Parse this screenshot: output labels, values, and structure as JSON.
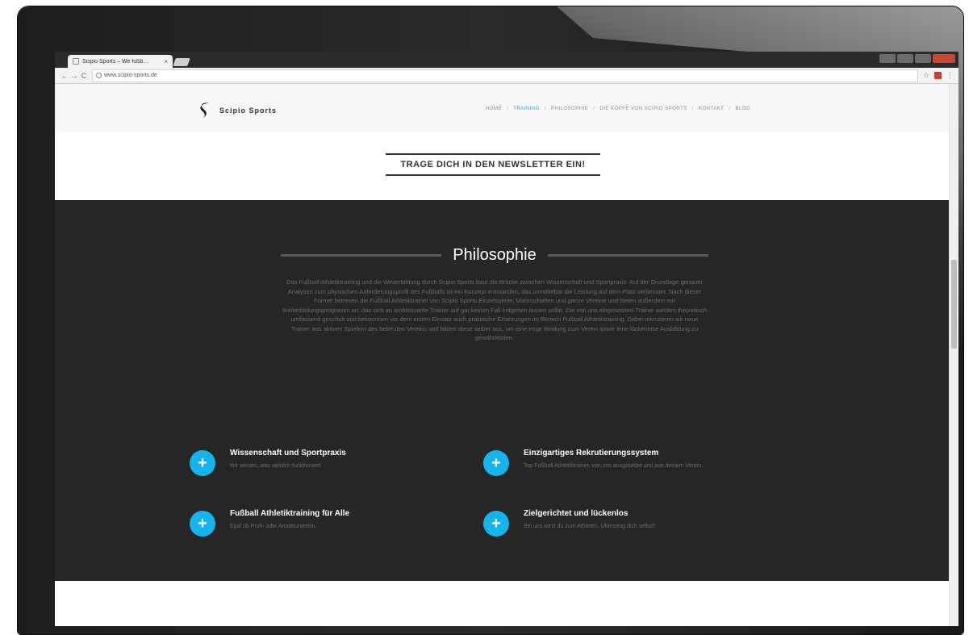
{
  "browser": {
    "tab_title": "Scipio Sports – We fußb…",
    "tab_close": "×",
    "url": "www.scipio-sports.de",
    "back": "←",
    "forward": "→",
    "reload": "C"
  },
  "site": {
    "logo_text": "Scipio Sports",
    "nav": [
      "HOME",
      "TRAINING",
      "PHILOSOPHIE",
      "DIE KÖPFE VON SCIPIO SPORTS",
      "KONTAKT",
      "BLOG"
    ],
    "nav_separator": "/",
    "active_nav": "TRAINING",
    "accent_color": "#1aa6e4"
  },
  "newsletter": {
    "button_label": "TRAGE DICH IN DEN NEWSLETTER EIN!"
  },
  "philosophy": {
    "title": "Philosophie",
    "text": "Das Fußball Athletiktraining und die Weiterbildung durch Scipio Sports baut die Brücke zwischen Wissenschaft und Sportpraxis. Auf der Grundlage genauer Analysen zum physischen Anforderungsprofil des Fußballs ist ein Konzept entstanden, das unmittelbar die Leistung auf dem Platz verbessert. Nach dieser Formel betreuen die Fußball Athletiktrainer von Scipio Sports Einzelspieler, Mannschaften und ganze Vereine und bieten außerdem ein Weiterbildungsprogramm an, das sich an ambitionierte Trainer auf gar keinen Fall entgehen lassen sollte. Die von uns eingesetzten Trainer werden theoretisch umfassend geschult und bekommen vor dem ersten Einsatz auch praktische Erfahrungen im Bereich Fußball Athletiktraining. Dabei rekrutieren wir neue Trainer aus aktiven Spielern des betreuten Vereins und bilden diese selber aus, um eine enge Bindung zum Verein sowie eine lückenlose Ausbildung zu gewährleisten."
  },
  "features": [
    {
      "title": "Wissenschaft und Sportpraxis",
      "desc": "Wir wissen, was wirklich funktioniert!"
    },
    {
      "title": "Einzigartiges Rekrutierungssystem",
      "desc": "Top Fußball Athletiktrainer, von uns ausgebildet und aus deinem Verein."
    },
    {
      "title": "Fußball Athletiktraining für Alle",
      "desc": "Egal ob Profi- oder Amateurverein."
    },
    {
      "title": "Zielgerichtet und lückenlos",
      "desc": "Bei uns wirst du zum Athleten. Überzeug dich selbst!"
    }
  ],
  "plus_glyph": "+"
}
